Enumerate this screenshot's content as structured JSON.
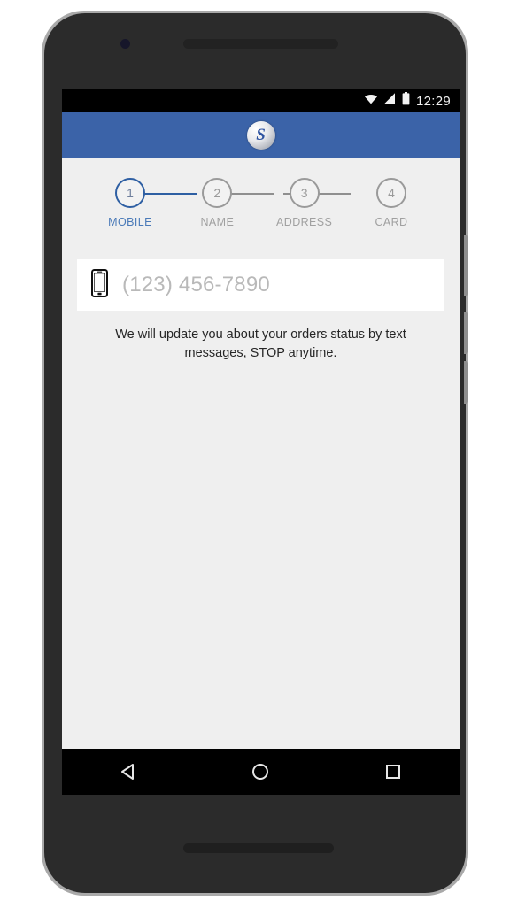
{
  "device": {
    "frame_color": "#2b2b2b",
    "bezel_color": "#a9a9a9",
    "camera_icon": "camera-dot",
    "speaker_icon": "speaker-grille"
  },
  "status_bar": {
    "time": "12:29",
    "icons": [
      "wifi-icon",
      "cell-signal-icon",
      "battery-icon"
    ],
    "background": "#000000",
    "foreground": "#f2f2f2"
  },
  "app_bar": {
    "background": "#3b63a8",
    "logo": {
      "icon": "brand-logo-icon",
      "letter": "S",
      "letter_color": "#2e53a0"
    }
  },
  "stepper": {
    "active_index": 0,
    "active_color": "#2e5fa3",
    "active_label_color": "#4a7ab8",
    "inactive_color": "#9a9a9a",
    "steps": [
      {
        "number": "1",
        "label": "MOBILE"
      },
      {
        "number": "2",
        "label": "NAME"
      },
      {
        "number": "3",
        "label": "ADDRESS"
      },
      {
        "number": "4",
        "label": "CARD"
      }
    ]
  },
  "form": {
    "phone_field": {
      "icon": "smartphone-icon",
      "value": "",
      "placeholder": "(123) 456-7890",
      "placeholder_color": "#b9b9b9",
      "background": "#ffffff"
    },
    "helper_text": "We will update you about your orders status by text messages, STOP anytime."
  },
  "screen": {
    "background": "#efefef"
  },
  "nav_bar": {
    "background": "#000000",
    "buttons": [
      {
        "name": "back-button",
        "icon": "triangle-back-icon"
      },
      {
        "name": "home-button",
        "icon": "circle-home-icon"
      },
      {
        "name": "recents-button",
        "icon": "square-recents-icon"
      }
    ]
  }
}
